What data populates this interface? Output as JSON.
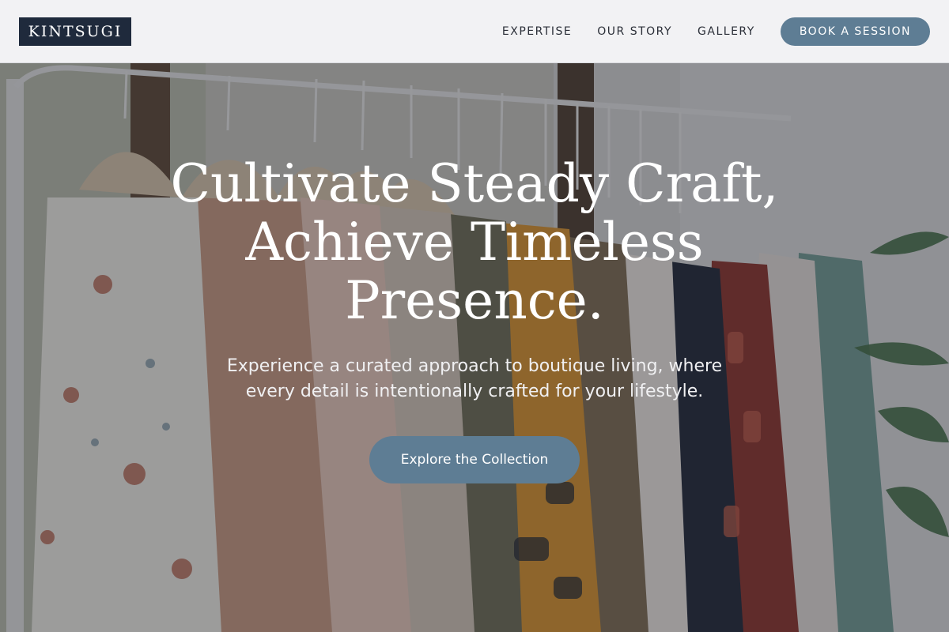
{
  "brand": {
    "logo_text": "KINTSUGI"
  },
  "nav": {
    "links": [
      {
        "label": "EXPERTISE"
      },
      {
        "label": "OUR STORY"
      },
      {
        "label": "GALLERY"
      }
    ],
    "cta_label": "BOOK A SESSION"
  },
  "hero": {
    "title": "Cultivate Steady Craft, Achieve Timeless Presence.",
    "subtitle": "Experience a curated approach to boutique living, where every detail is intentionally crafted for your lifestyle.",
    "cta_label": "Explore the Collection",
    "background_image": "clothing-rack-photo"
  },
  "colors": {
    "accent": "#5e7d94",
    "logo_bg": "#1f2a3c",
    "nav_bg": "#f6f6f8",
    "nav_text": "#2b2f38",
    "hero_text": "#ffffff"
  }
}
